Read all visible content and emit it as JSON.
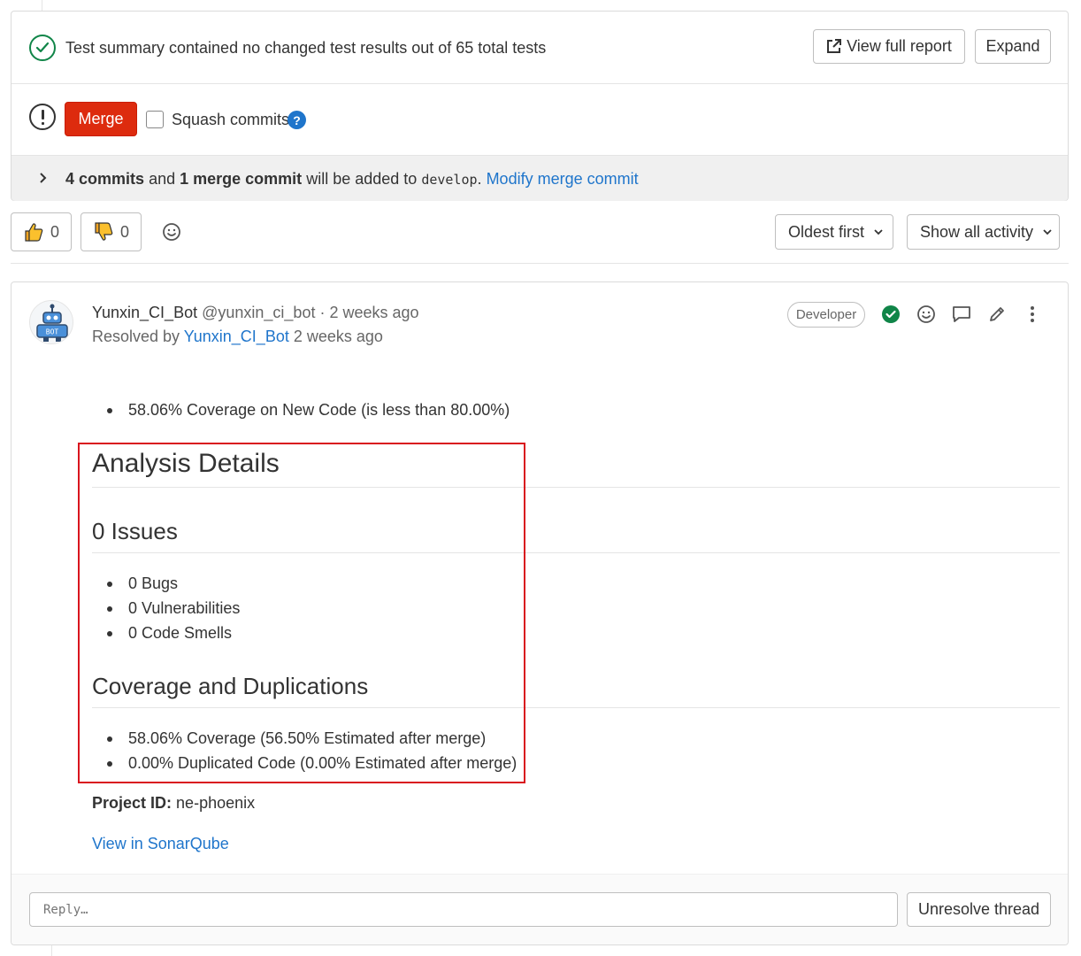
{
  "test_summary": {
    "text": "Test summary contained no changed test results out of 65 total tests",
    "view_report_label": "View full report",
    "expand_label": "Expand"
  },
  "merge": {
    "button_label": "Merge",
    "squash_label": "Squash commits",
    "help_glyph": "?"
  },
  "commits_info": {
    "commits": "4 commits",
    "and": "and",
    "merge_commit": "1 merge commit",
    "will_be_added": "will be added to",
    "branch": "develop",
    "period": ".",
    "modify_link": "Modify merge commit"
  },
  "reactions": {
    "thumbs_up_count": "0",
    "thumbs_down_count": "0"
  },
  "filters": {
    "sort_label": "Oldest first",
    "activity_label": "Show all activity"
  },
  "note": {
    "author_name": "Yunxin_CI_Bot",
    "author_handle": "@yunxin_ci_bot",
    "separator": "·",
    "time_ago": "2 weeks ago",
    "resolved_by_label": "Resolved by",
    "resolved_by_name": "Yunxin_CI_Bot",
    "resolved_time": "2 weeks ago",
    "role_badge": "Developer",
    "coverage_bullet": "58.06% Coverage on New Code (is less than 80.00%)",
    "analysis_heading": "Analysis Details",
    "issues_heading": "0 Issues",
    "issues": [
      "0 Bugs",
      "0 Vulnerabilities",
      "0 Code Smells"
    ],
    "coverage_heading": "Coverage and Duplications",
    "coverage_items": [
      "58.06% Coverage (56.50% Estimated after merge)",
      "0.00% Duplicated Code (0.00% Estimated after merge)"
    ],
    "project_id_label": "Project ID:",
    "project_id_value": "ne-phoenix",
    "sonar_link": "View in SonarQube",
    "reply_placeholder": "Reply…",
    "unresolve_label": "Unresolve thread"
  },
  "colors": {
    "merge_button": "#dd2b0e",
    "link": "#1f75cb",
    "success": "#108548",
    "highlight_box": "#d9151e"
  }
}
